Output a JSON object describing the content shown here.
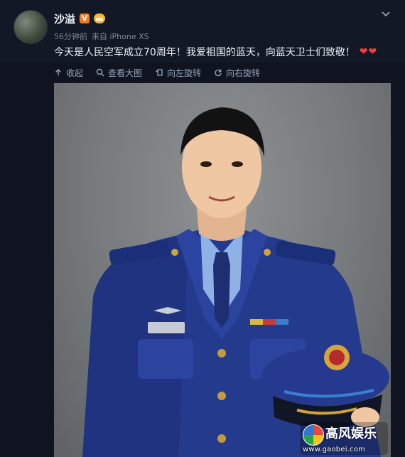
{
  "post": {
    "username": "沙溢",
    "verified_badge": "V",
    "time": "56分钟前",
    "source": "来自 iPhone XS",
    "text": "今天是人民空军成立70周年！我爱祖国的蓝天，向蓝天卫士们致敬！",
    "hearts": "❤❤"
  },
  "toolbar": {
    "collapse": "收起",
    "view_large": "查看大图",
    "rotate_left": "向左旋转",
    "rotate_right": "向右旋转"
  },
  "watermark": {
    "brand": "高风娱乐",
    "url": "www.gaobei.com"
  },
  "colors": {
    "background": "#0f1420",
    "accent_orange": "#f27b1a",
    "heart_red": "#ff3b3b",
    "uniform_blue": "#243a8c"
  },
  "icons": [
    "avatar",
    "verified-v-icon",
    "crown-badge-icon",
    "chevron-down-icon",
    "collapse-up-icon",
    "magnify-icon",
    "rotate-left-icon",
    "rotate-right-icon"
  ]
}
